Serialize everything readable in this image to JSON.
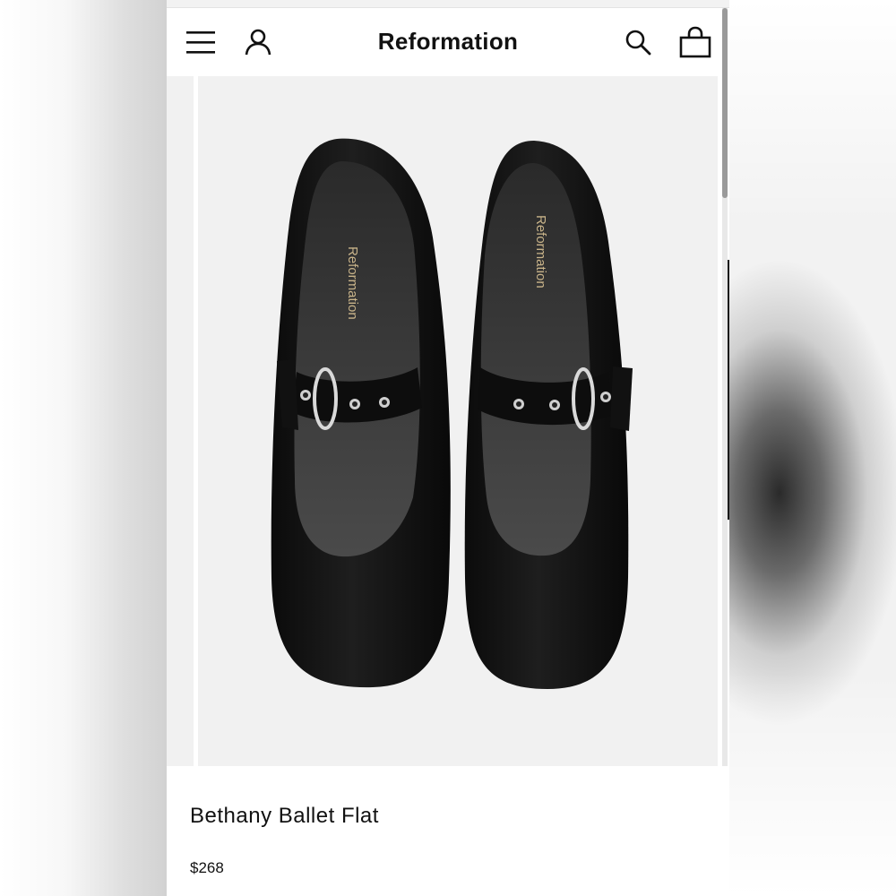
{
  "header": {
    "brand": "Reformation",
    "icons": [
      "menu-icon",
      "account-icon",
      "search-icon",
      "bag-icon"
    ]
  },
  "gallery": {
    "insole_print_left": "Reformation",
    "insole_print_right": "Reformation"
  },
  "product": {
    "name": "Bethany Ballet Flat",
    "price": "$268"
  },
  "colors": {
    "text": "#111111",
    "image_background": "#f1f1f1",
    "shoe": "#111111"
  }
}
